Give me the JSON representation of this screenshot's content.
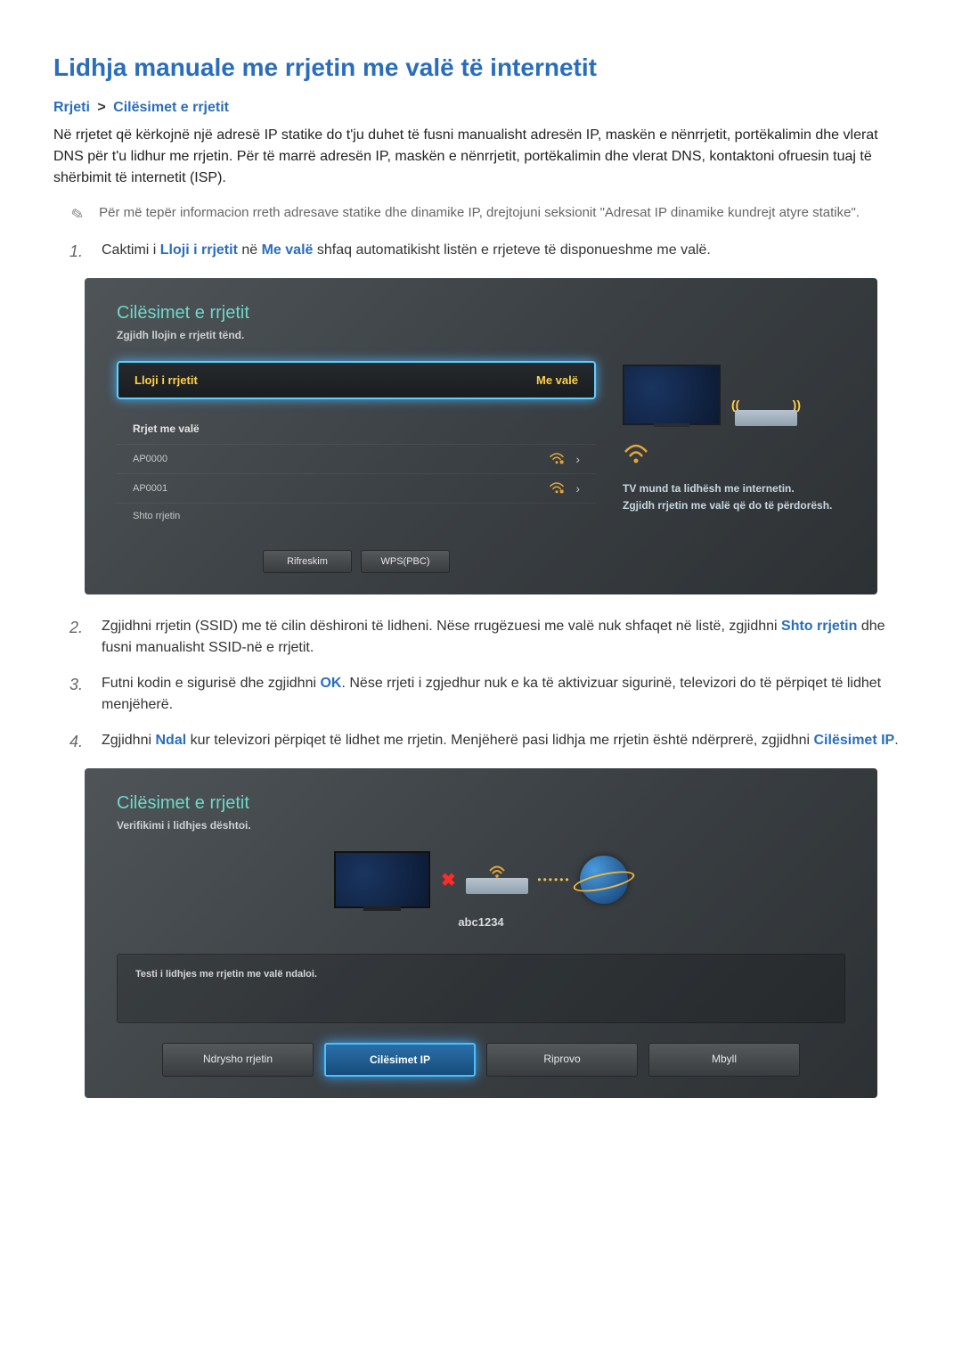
{
  "page": {
    "title": "Lidhja manuale me rrjetin me valë të internetit"
  },
  "breadcrumb": {
    "part1": "Rrjeti",
    "sep": ">",
    "part2": "Cilësimet e rrjetit"
  },
  "intro": "Në rrjetet që kërkojnë një adresë IP statike do t'ju duhet të fusni manualisht adresën IP, maskën e nënrrjetit, portëkalimin dhe vlerat DNS për t'u lidhur me rrjetin. Për të marrë adresën IP, maskën e nënrrjetit, portëkalimin dhe vlerat DNS, kontaktoni ofruesin tuaj të shërbimit të internetit (ISP).",
  "note": "Për më tepër informacion rreth adresave statike dhe dinamike IP, drejtojuni seksionit \"Adresat IP dinamike kundrejt atyre statike\".",
  "step1": {
    "prefix": "Caktimi i ",
    "link1": "Lloji i rrjetit",
    "mid": " në ",
    "link2": "Me valë",
    "suffix": " shfaq automatikisht listën e rrjeteve të disponueshme me valë."
  },
  "step2": {
    "prefix": "Zgjidhni rrjetin (SSID) me të cilin dëshironi të lidheni. Nëse rrugëzuesi me valë nuk shfaqet në listë, zgjidhni ",
    "link": "Shto rrjetin",
    "suffix": " dhe fusni manualisht SSID-në e rrjetit."
  },
  "step3": {
    "prefix": "Futni kodin e sigurisë dhe zgjidhni ",
    "link": "OK",
    "suffix": ". Nëse rrjeti i zgjedhur nuk e ka të aktivizuar sigurinë, televizori do të përpiqet të lidhet menjëherë."
  },
  "step4": {
    "prefix": "Zgjidhni ",
    "link1": "Ndal",
    "mid": " kur televizori përpiqet të lidhet me rrjetin. Menjëherë pasi lidhja me rrjetin është ndërprerë, zgjidhni ",
    "link2": "Cilësimet IP",
    "suffix": "."
  },
  "panel1": {
    "title": "Cilësimet e rrjetit",
    "subtitle": "Zgjidh llojin e rrjetit tënd.",
    "select_label": "Lloji i rrjetit",
    "select_value": "Me valë",
    "list_header": "Rrjet me valë",
    "aps": [
      {
        "name": "AP0000"
      },
      {
        "name": "AP0001"
      }
    ],
    "add_network": "Shto rrjetin",
    "btn_refresh": "Rifreskim",
    "btn_wps": "WPS(PBC)",
    "side_msg_l1": "TV mund ta lidhësh me internetin.",
    "side_msg_l2": "Zgjidh rrjetin me valë që do të përdorësh."
  },
  "panel2": {
    "title": "Cilësimet e rrjetit",
    "subtitle": "Verifikimi i lidhjes dështoi.",
    "ssid": "abc1234",
    "info": "Testi i lidhjes me rrjetin me valë ndaloi.",
    "btn_change": "Ndrysho rrjetin",
    "btn_ip": "Cilësimet IP",
    "btn_retry": "Riprovo",
    "btn_close": "Mbyll"
  },
  "nums": {
    "n1": "1.",
    "n2": "2.",
    "n3": "3.",
    "n4": "4."
  }
}
